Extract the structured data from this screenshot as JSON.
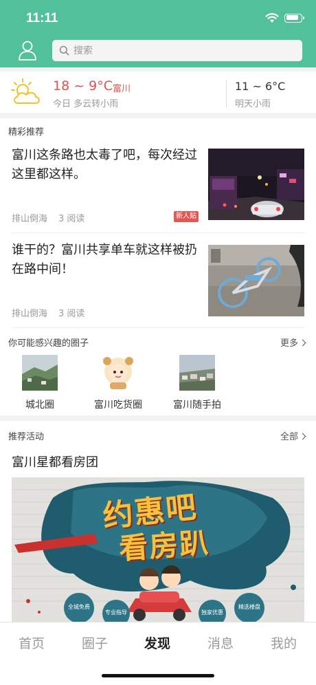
{
  "status_bar": {
    "time": "11:11",
    "battery_level": 0.85
  },
  "header": {
    "search": {
      "placeholder": "搜索"
    }
  },
  "weather": {
    "icon": "sun-cloud-icon",
    "today": {
      "temp": "18 ~ 9°C",
      "city": "富川",
      "desc": "今日 多云转小雨"
    },
    "tomorrow": {
      "temp": "11 ~ 6°C",
      "desc": "明天小雨"
    },
    "colors": {
      "today": "#e1504c"
    }
  },
  "featured": {
    "title": "精彩推荐",
    "articles": [
      {
        "title": "富川这条路也太毒了吧，每次经过这里都这样。",
        "author": "排山倒海",
        "reads": "3 阅读",
        "badge": "新人贴"
      },
      {
        "title": "谁干的？富川共享单车就这样被扔在路中间！",
        "author": "排山倒海",
        "reads": "3 阅读"
      }
    ]
  },
  "circles": {
    "title": "你可能感兴趣的圈子",
    "more": "更多",
    "items": [
      {
        "name": "城北圈"
      },
      {
        "name": "富川吃货圈"
      },
      {
        "name": "富川随手拍"
      }
    ]
  },
  "activities": {
    "title": "推荐活动",
    "all": "全部",
    "item": {
      "title": "富川星都看房团",
      "banner": {
        "headline_1": "约惠吧",
        "headline_2": "看房趴",
        "badges": [
          "全城免费",
          "专业指导",
          "独家优惠",
          "精选楼盘"
        ]
      }
    }
  },
  "tabbar": {
    "tabs": [
      {
        "label": "首页"
      },
      {
        "label": "圈子"
      },
      {
        "label": "发现",
        "active": true
      },
      {
        "label": "消息"
      },
      {
        "label": "我的"
      }
    ]
  },
  "colors": {
    "primary": "#52c09b",
    "badge": "#e35654"
  }
}
